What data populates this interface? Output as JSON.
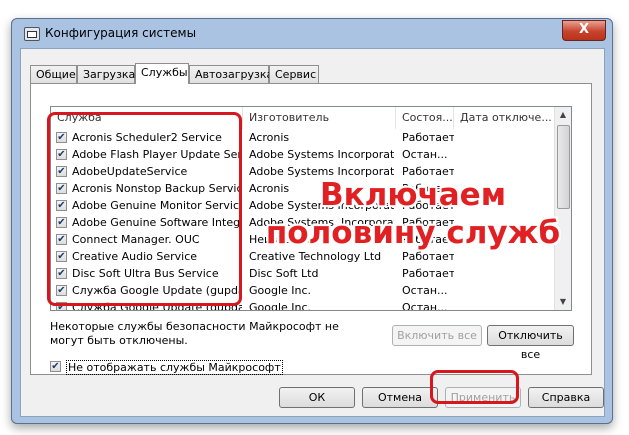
{
  "window": {
    "title": "Конфигурация системы",
    "close_glyph": "X"
  },
  "tabs": [
    "Общие",
    "Загрузка",
    "Службы",
    "Автозагрузка",
    "Сервис"
  ],
  "active_tab": "Службы",
  "columns": [
    "Служба",
    "Изготовитель",
    "Состоя...",
    "Дата отключе..."
  ],
  "services": [
    {
      "name": "Acronis Scheduler2 Service",
      "vendor": "Acronis",
      "status": "Работает",
      "date": "",
      "checked": true
    },
    {
      "name": "Adobe Flash Player Update Service",
      "vendor": "Adobe Systems Incorporated",
      "status": "Остан...",
      "date": "",
      "checked": true
    },
    {
      "name": "AdobeUpdateService",
      "vendor": "Adobe Systems Incorporated",
      "status": "Работает",
      "date": "",
      "checked": true
    },
    {
      "name": "Acronis Nonstop Backup Service",
      "vendor": "Acronis",
      "status": "Работает",
      "date": "",
      "checked": true
    },
    {
      "name": "Adobe Genuine Monitor Service",
      "vendor": "Adobe Systems Incorporated",
      "status": "Работает",
      "date": "",
      "checked": true
    },
    {
      "name": "Adobe Genuine Software Integri...",
      "vendor": "Adobe Systems, Incorporated",
      "status": "Работает",
      "date": "",
      "checked": true
    },
    {
      "name": "Connect Manager. OUC",
      "vendor": "Неизвестно",
      "status": "Работает",
      "date": "",
      "checked": true
    },
    {
      "name": "Creative Audio Service",
      "vendor": "Creative Technology Ltd",
      "status": "Работает",
      "date": "",
      "checked": true
    },
    {
      "name": "Disc Soft Ultra Bus Service",
      "vendor": "Disc Soft Ltd",
      "status": "Работает",
      "date": "",
      "checked": true
    },
    {
      "name": "Служба Google Update (gupdate)",
      "vendor": "Google Inc.",
      "status": "Остан...",
      "date": "",
      "checked": true
    },
    {
      "name": "Служба Google Update (gupdat...",
      "vendor": "Google Inc.",
      "status": "Остан...",
      "date": "",
      "checked": true
    }
  ],
  "note": "Некоторые службы безопасности Майкрософт не могут быть отключены.",
  "buttons": {
    "enable_all": "Включить все",
    "disable_all": "Отключить все",
    "ok": "ОК",
    "cancel": "Отмена",
    "apply": "Применить",
    "help": "Справка"
  },
  "hide_ms": {
    "label": "Не отображать службы Майкрософт",
    "checked": true
  },
  "overlay_text": [
    "Включаем",
    "половину служб"
  ],
  "accent_colors": {
    "annotation": "#d8161e",
    "close": "#c7432d",
    "frame": "#aac3e2"
  },
  "icons": {
    "check": "✔",
    "scroll_up": "▲",
    "scroll_down": "▼"
  }
}
